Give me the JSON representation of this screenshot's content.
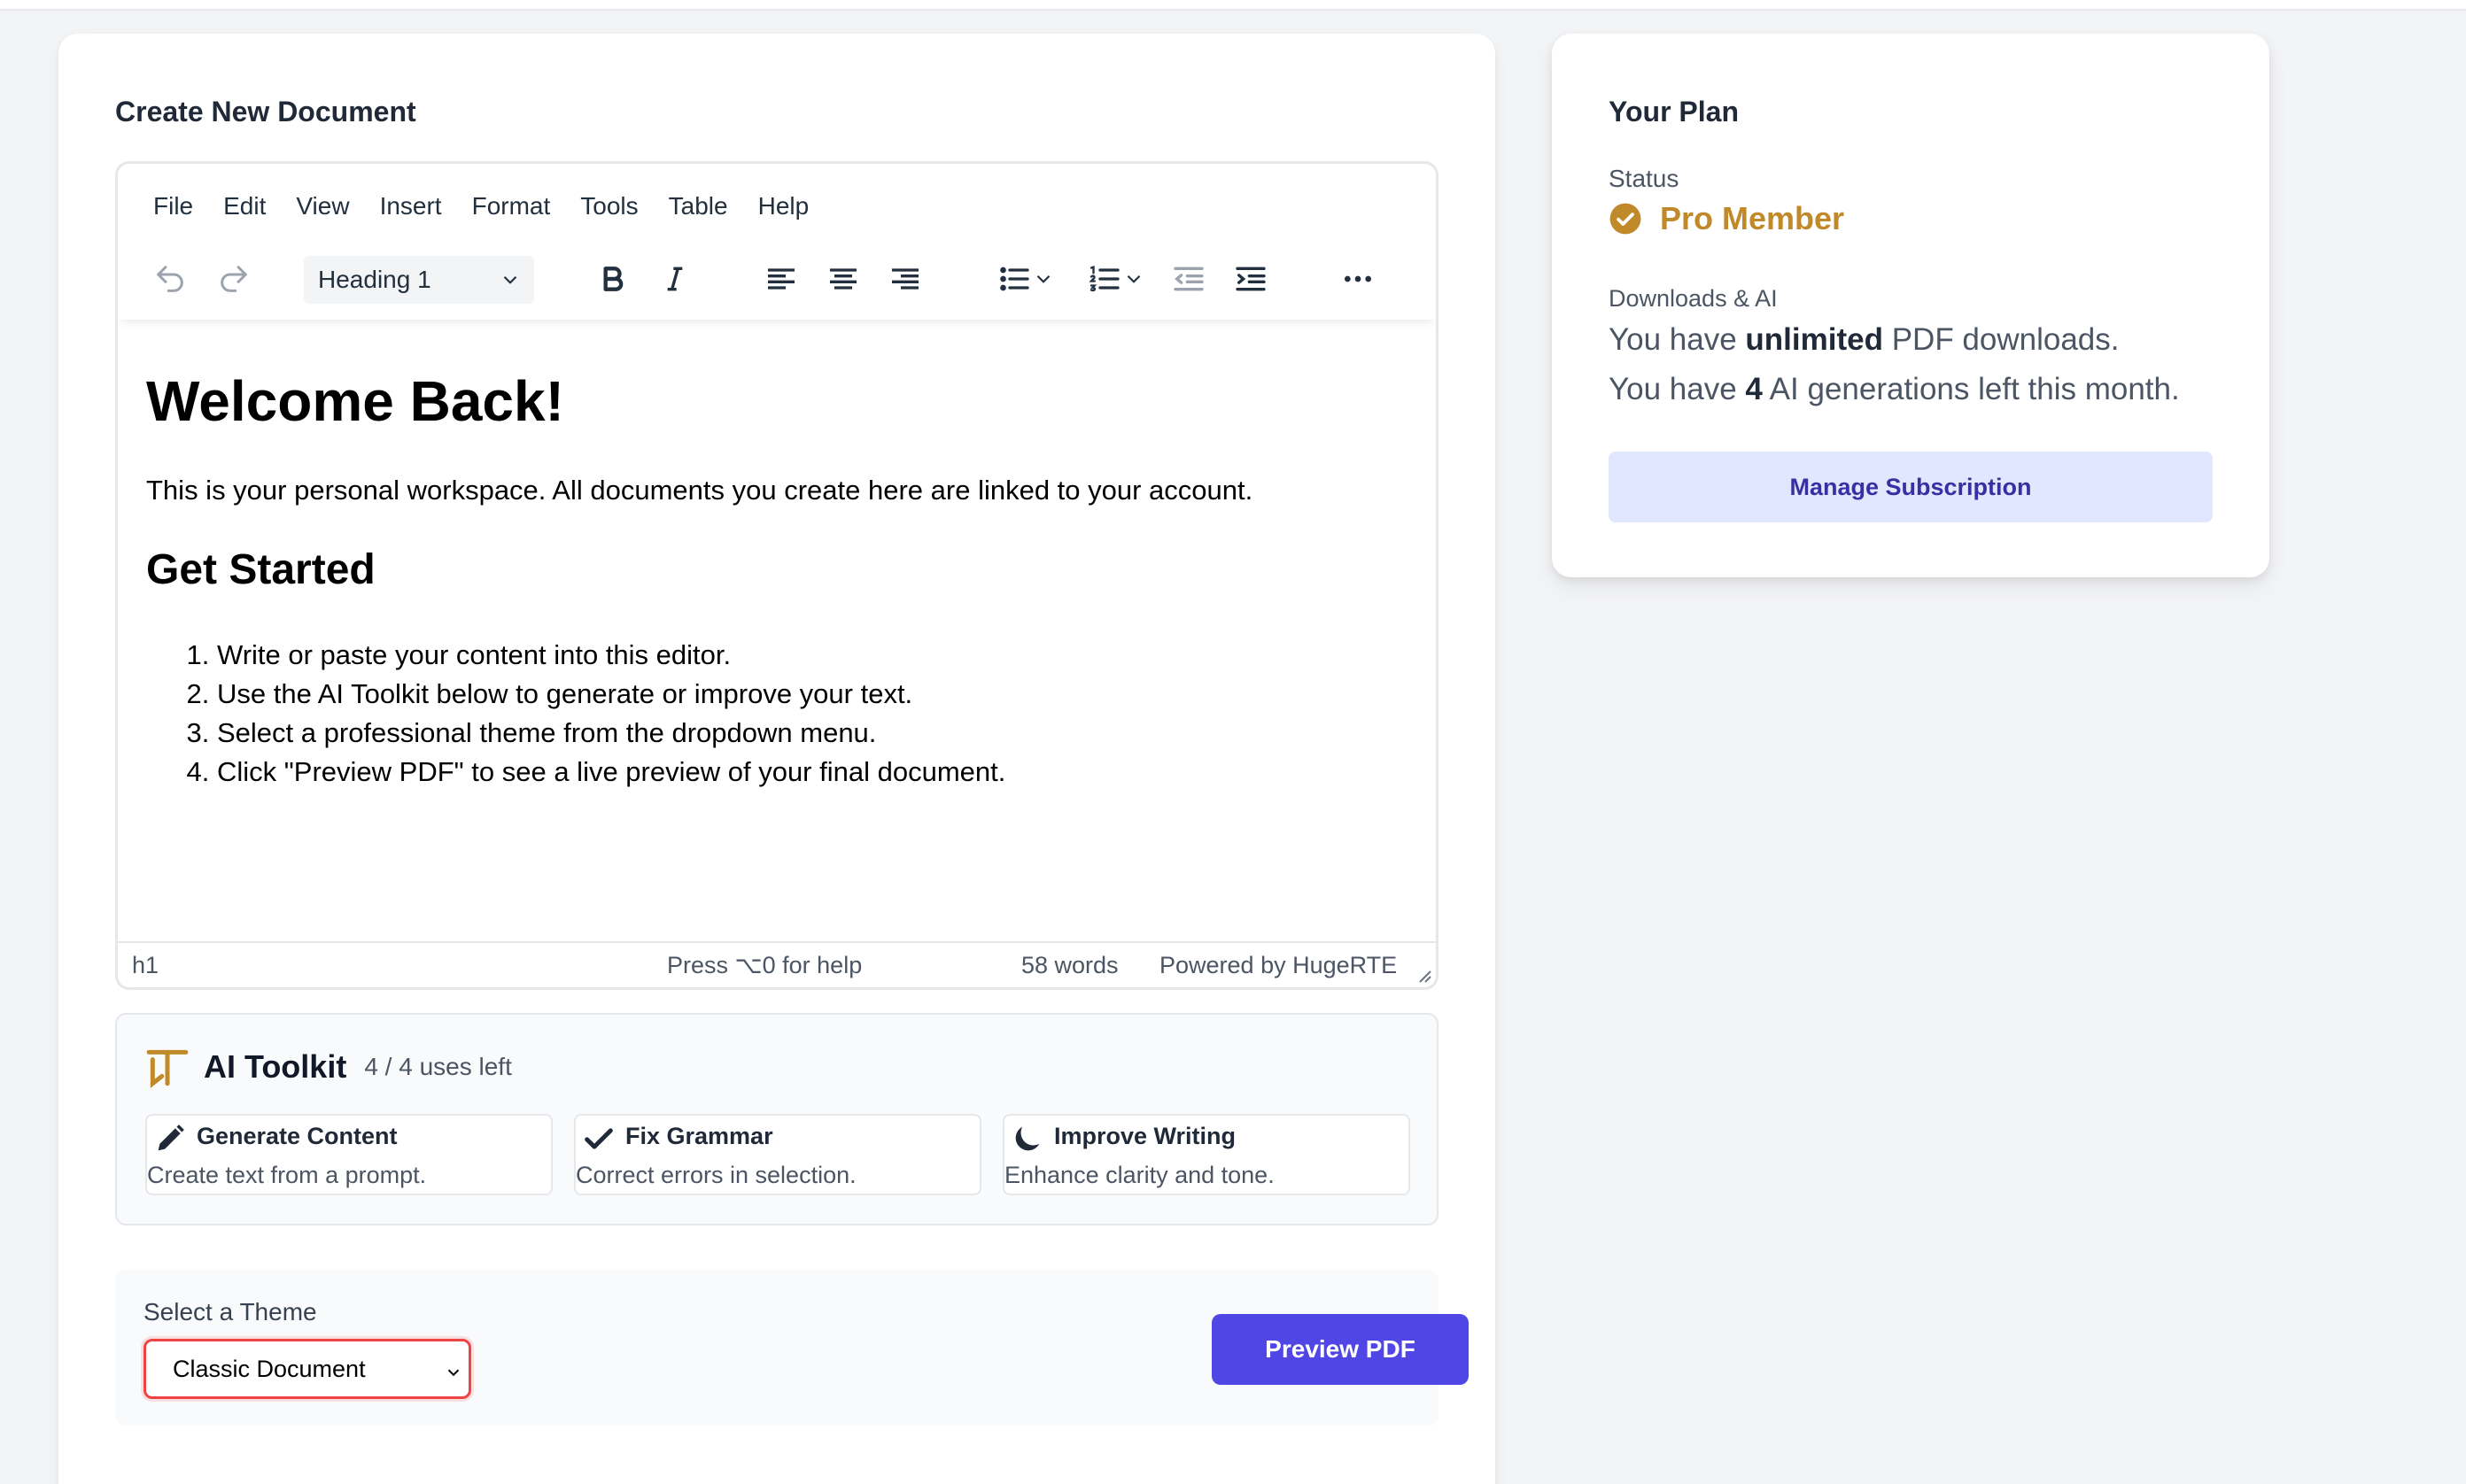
{
  "editor_card": {
    "title": "Create New Document",
    "menu": [
      "File",
      "Edit",
      "View",
      "Insert",
      "Format",
      "Tools",
      "Table",
      "Help"
    ],
    "block_format": "Heading 1",
    "content": {
      "heading": "Welcome Back!",
      "intro": "This is your personal workspace. All documents you create here are linked to your account.",
      "subheading": "Get Started",
      "steps": [
        "Write or paste your content into this editor.",
        "Use the AI Toolkit below to generate or improve your text.",
        "Select a professional theme from the dropdown menu.",
        "Click \"Preview PDF\" to see a live preview of your final document."
      ]
    },
    "status": {
      "element_path": "h1",
      "help": "Press ⌥0 for help",
      "word_count": "58 words",
      "branding": "Powered by HugeRTE"
    }
  },
  "ai_toolkit": {
    "title": "AI Toolkit",
    "uses": "4 / 4 uses left",
    "options": [
      {
        "title": "Generate Content",
        "desc": "Create text from a prompt.",
        "icon": "pencil-icon"
      },
      {
        "title": "Fix Grammar",
        "desc": "Correct errors in selection.",
        "icon": "check-icon"
      },
      {
        "title": "Improve Writing",
        "desc": "Enhance clarity and tone.",
        "icon": "moon-icon"
      }
    ]
  },
  "theme": {
    "label": "Select a Theme",
    "selected": "Classic Document",
    "preview_button": "Preview PDF"
  },
  "plan": {
    "title": "Your Plan",
    "status_label": "Status",
    "status": "Pro Member",
    "downloads_label": "Downloads & AI",
    "line1_pre": "You have ",
    "line1_bold": "unlimited",
    "line1_post": " PDF downloads.",
    "line2_pre": "You have ",
    "line2_bold": "4",
    "line2_post": " AI generations left this month.",
    "manage_button": "Manage Subscription"
  },
  "colors": {
    "accent": "#4f46e5",
    "gold": "#c08a2a",
    "manage_bg": "#e0e7ff",
    "theme_border": "#ef4444"
  }
}
